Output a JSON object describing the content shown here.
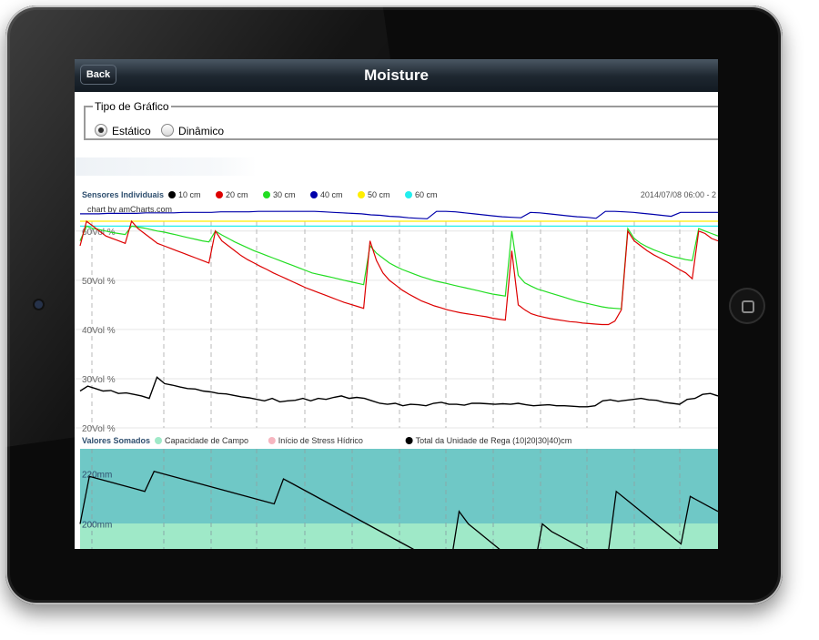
{
  "nav": {
    "back_label": "Back",
    "title": "Moisture"
  },
  "chart_type": {
    "legend": "Tipo de Gráfico",
    "options": [
      {
        "label": "Estático",
        "selected": true
      },
      {
        "label": "Dinâmico",
        "selected": false
      }
    ]
  },
  "chart_data": [
    {
      "type": "line",
      "title": "Sensores Individuais",
      "credit": "chart by amCharts.com",
      "date_label": "2014/07/08 06:00 - 2",
      "y_ticks": [
        "60Vol %",
        "50Vol %",
        "40Vol %",
        "30Vol %",
        "20Vol %"
      ],
      "ylim": [
        20,
        62
      ],
      "series": [
        {
          "name": "10 cm",
          "color": "#000000",
          "y": [
            27.5,
            28.5,
            28,
            27.5,
            27.6,
            27,
            27.1,
            26.8,
            26.5,
            26,
            30.3,
            29,
            28.7,
            28.3,
            28,
            27.9,
            27.5,
            27.3,
            27,
            26.9,
            26.6,
            26.3,
            26.1,
            25.8,
            25.5,
            26,
            25.3,
            25.5,
            25.6,
            26,
            25.5,
            26,
            25.8,
            26.2,
            26.5,
            26,
            26.2,
            26,
            25.5,
            25,
            24.8,
            25,
            24.5,
            24.8,
            24.7,
            24.5,
            25,
            25.2,
            24.8,
            24.8,
            24.6,
            25,
            25,
            24.9,
            24.8,
            24.9,
            24.8,
            25,
            24.7,
            24.5,
            24.6,
            24.7,
            24.5,
            24.5,
            24.4,
            24.3,
            24.3,
            24.5,
            25.5,
            25.7,
            25.4,
            25.6,
            25.8,
            26,
            25.7,
            25.6,
            25.2,
            25,
            24.8,
            25.8,
            26,
            26.8,
            27,
            26.5
          ]
        },
        {
          "name": "20 cm",
          "color": "#dd0000",
          "y": [
            57,
            62,
            61,
            60,
            59,
            58.5,
            58,
            57.5,
            62,
            60.5,
            59.5,
            58.5,
            57.5,
            57,
            56.5,
            56,
            55.5,
            55,
            54.5,
            54,
            53.5,
            60,
            58,
            57,
            56,
            55,
            54.2,
            53.5,
            52.8,
            52.2,
            51.5,
            50.9,
            50.3,
            49.7,
            49.1,
            48.5,
            48,
            47.5,
            47,
            46.5,
            46,
            45.5,
            45.1,
            44.7,
            44.3,
            58,
            54,
            51.5,
            50,
            49,
            48,
            47.2,
            46.5,
            45.8,
            45.3,
            44.8,
            44.4,
            44,
            43.7,
            43.4,
            43.2,
            43,
            42.8,
            42.6,
            42.3,
            42.1,
            41.9,
            56,
            45,
            44,
            43.2,
            42.8,
            42.5,
            42.2,
            42,
            41.8,
            41.6,
            41.5,
            41.3,
            41.2,
            41.1,
            41,
            41,
            41.7,
            44,
            60,
            58,
            57,
            56,
            55.2,
            54.5,
            53.8,
            53,
            52.2,
            51.5,
            50.3,
            60,
            59.5,
            58.5,
            58
          ]
        },
        {
          "name": "30 cm",
          "color": "#22dd22",
          "y": [
            58,
            61,
            60.5,
            60.3,
            60,
            59.7,
            59.5,
            59.3,
            61,
            60.8,
            60.6,
            60.3,
            60,
            59.8,
            59.5,
            59.2,
            58.9,
            58.6,
            58.3,
            58,
            57.8,
            60,
            59.2,
            58.5,
            57.8,
            57.2,
            56.6,
            56,
            55.5,
            55,
            54.5,
            54,
            53.5,
            53,
            52.5,
            52,
            51.5,
            51.2,
            50.9,
            50.6,
            50.3,
            50,
            49.7,
            49.4,
            49.1,
            57,
            55.5,
            54.5,
            53.5,
            52.8,
            52.2,
            51.7,
            51.2,
            50.7,
            50.3,
            49.9,
            49.6,
            49.3,
            49,
            48.7,
            48.4,
            48.1,
            47.8,
            47.5,
            47.2,
            47,
            46.8,
            60,
            51,
            49.5,
            48.8,
            48.2,
            47.8,
            47.4,
            47,
            46.6,
            46.2,
            45.8,
            45.5,
            45.2,
            44.9,
            44.6,
            44.4,
            44.3,
            44.2,
            60.5,
            58.5,
            57.5,
            56.8,
            56.2,
            55.7,
            55.2,
            54.8,
            54.5,
            54.2,
            54,
            60.5,
            60,
            59.5,
            59
          ]
        },
        {
          "name": "40 cm",
          "color": "#0000aa",
          "y": [
            63.5,
            63.5,
            63.5,
            63.6,
            63.6,
            63.6,
            63.6,
            63.7,
            63.7,
            63.7,
            63.7,
            63.8,
            63.8,
            63.8,
            63.8,
            63.9,
            63.9,
            63.9,
            63.9,
            64,
            64,
            64,
            64,
            64,
            64,
            64,
            63.9,
            63.8,
            63.7,
            63.6,
            63.5,
            63.3,
            63.2,
            63,
            62.9,
            62.7,
            62.6,
            62.5,
            64,
            64,
            63.9,
            63.7,
            63.5,
            63.3,
            63.1,
            62.9,
            62.8,
            62.7,
            63.8,
            63.7,
            63.5,
            63.3,
            63.1,
            62.9,
            62.8,
            62.6,
            64,
            64,
            63.9,
            63.8,
            63.6,
            63.4,
            63.2,
            63,
            63.8,
            63.8,
            63.8,
            63.8,
            63.8
          ]
        },
        {
          "name": "50 cm",
          "color": "#ffee00",
          "y": [
            62,
            62,
            62,
            62,
            62,
            62,
            62,
            62,
            62,
            62,
            62,
            62,
            62,
            62,
            62,
            62,
            62,
            62,
            62,
            62,
            62,
            62,
            62,
            62,
            62,
            62,
            62,
            62,
            62,
            62,
            62,
            62,
            62,
            62,
            62,
            62,
            62,
            62,
            62,
            62,
            62,
            62,
            62,
            62,
            62,
            62,
            62,
            62,
            62,
            62,
            62,
            62,
            62,
            62,
            62,
            62
          ]
        },
        {
          "name": "60 cm",
          "color": "#22eeee",
          "y": [
            61,
            61,
            61,
            61,
            61,
            61,
            61,
            61,
            61,
            61,
            61,
            61,
            61,
            61,
            61,
            61,
            61,
            61,
            61,
            61,
            61,
            61,
            61,
            61,
            61,
            61,
            61,
            61,
            61,
            61,
            61,
            61,
            61,
            61,
            61,
            61,
            61,
            61,
            61,
            61,
            61,
            61,
            61,
            61,
            61,
            61,
            61,
            61,
            61,
            61,
            61,
            61,
            61,
            61,
            61,
            61
          ]
        }
      ]
    },
    {
      "type": "area",
      "title": "Valores Somados",
      "y_ticks": [
        "220mm",
        "200mm"
      ],
      "ylim": [
        190,
        230
      ],
      "bands": [
        {
          "name": "Capacidade de Campo",
          "color": "#9fe9c8"
        },
        {
          "name": "Início de Stress Hídrico",
          "color": "#f6b6c0"
        }
      ],
      "series": [
        {
          "name": "Total da Unidade de Rega (10|20|30|40)cm",
          "color": "#000000",
          "y": [
            200,
            219,
            218,
            217,
            216,
            215,
            214,
            213,
            221,
            220,
            219,
            218,
            217,
            216,
            215,
            214,
            213,
            212,
            211,
            210,
            209,
            208,
            218,
            216,
            214,
            212,
            210,
            208,
            206,
            204,
            202,
            200,
            198,
            196,
            194,
            192,
            190,
            188,
            186,
            184,
            182,
            205,
            200,
            197,
            194,
            191,
            188,
            185,
            182,
            180,
            200,
            197,
            195,
            193,
            191,
            189,
            187,
            185,
            213,
            210,
            207,
            204,
            201,
            198,
            195,
            192,
            211,
            209,
            207,
            205
          ]
        }
      ]
    }
  ]
}
